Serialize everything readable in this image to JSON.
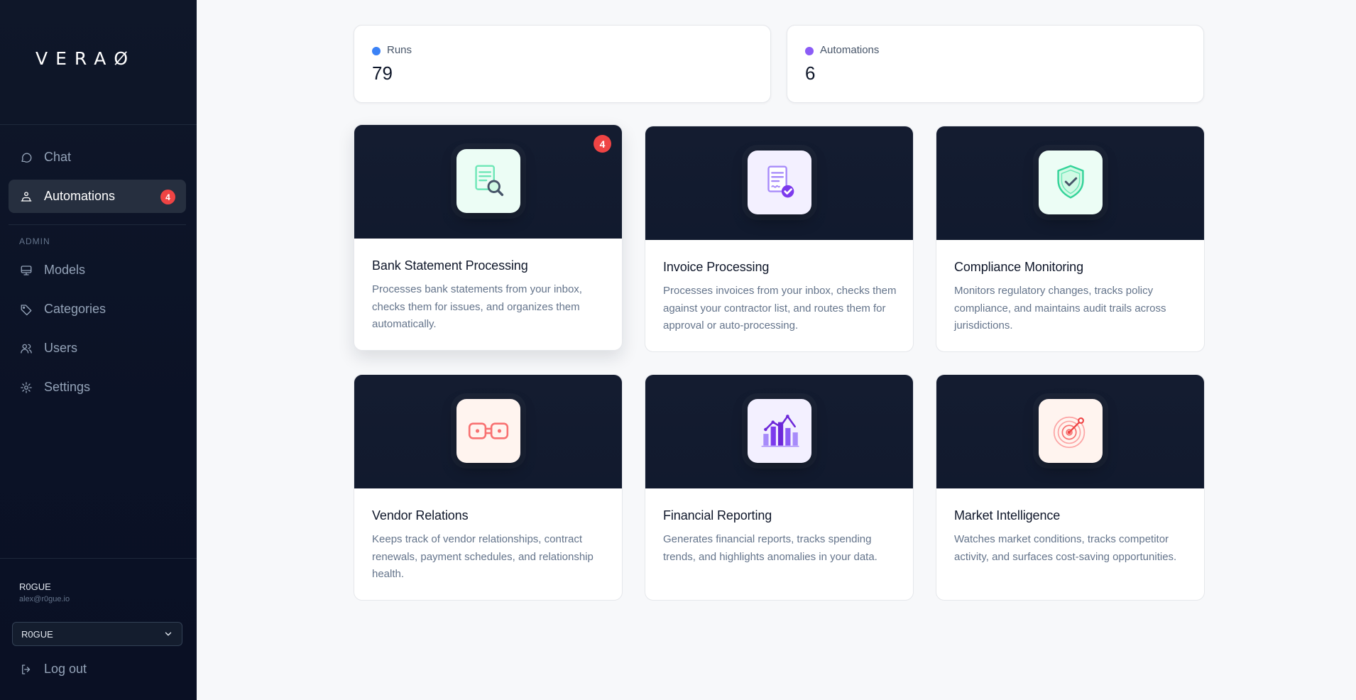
{
  "brand": {
    "logo": "VERAØ"
  },
  "nav": {
    "items": [
      {
        "label": "Chat",
        "icon": "chat-bubble-icon"
      },
      {
        "label": "Automations",
        "icon": "automation-icon",
        "badge": "4",
        "active": true
      }
    ],
    "admin_label": "ADMIN",
    "admin_items": [
      {
        "label": "Models",
        "icon": "monitor-icon"
      },
      {
        "label": "Categories",
        "icon": "tag-icon"
      },
      {
        "label": "Users",
        "icon": "users-icon"
      },
      {
        "label": "Settings",
        "icon": "gear-icon"
      }
    ]
  },
  "user": {
    "name": "R0GUE",
    "email": "alex@r0gue.io",
    "org_select": "R0GUE",
    "logout_label": "Log out"
  },
  "stats": [
    {
      "label": "Runs",
      "value": "79",
      "color": "#3b82f6"
    },
    {
      "label": "Automations",
      "value": "6",
      "color": "#8b5cf6"
    }
  ],
  "automations": [
    {
      "title": "Bank Statement Processing",
      "description": "Processes bank statements from your inbox, checks them for issues, and organizes them automatically.",
      "icon": "document-search-icon",
      "tile_color": "#ecfdf5",
      "badge": "4"
    },
    {
      "title": "Invoice Processing",
      "description": "Processes invoices from your inbox, checks them against your contractor list, and routes them for approval or auto-processing.",
      "icon": "invoice-check-icon",
      "tile_color": "#f3f0ff"
    },
    {
      "title": "Compliance Monitoring",
      "description": "Monitors regulatory changes, tracks policy compliance, and maintains audit trails across jurisdictions.",
      "icon": "shield-check-icon",
      "tile_color": "#ecfdf5"
    },
    {
      "title": "Vendor Relations",
      "description": "Keeps track of vendor relationships, contract renewals, payment schedules, and relationship health.",
      "icon": "link-icon",
      "tile_color": "#fff4ef"
    },
    {
      "title": "Financial Reporting",
      "description": "Generates financial reports, tracks spending trends, and highlights anomalies in your data.",
      "icon": "bar-chart-icon",
      "tile_color": "#f3f0ff"
    },
    {
      "title": "Market Intelligence",
      "description": "Watches market conditions, tracks competitor activity, and surfaces cost-saving opportunities.",
      "icon": "radar-icon",
      "tile_color": "#fff4ef"
    }
  ]
}
